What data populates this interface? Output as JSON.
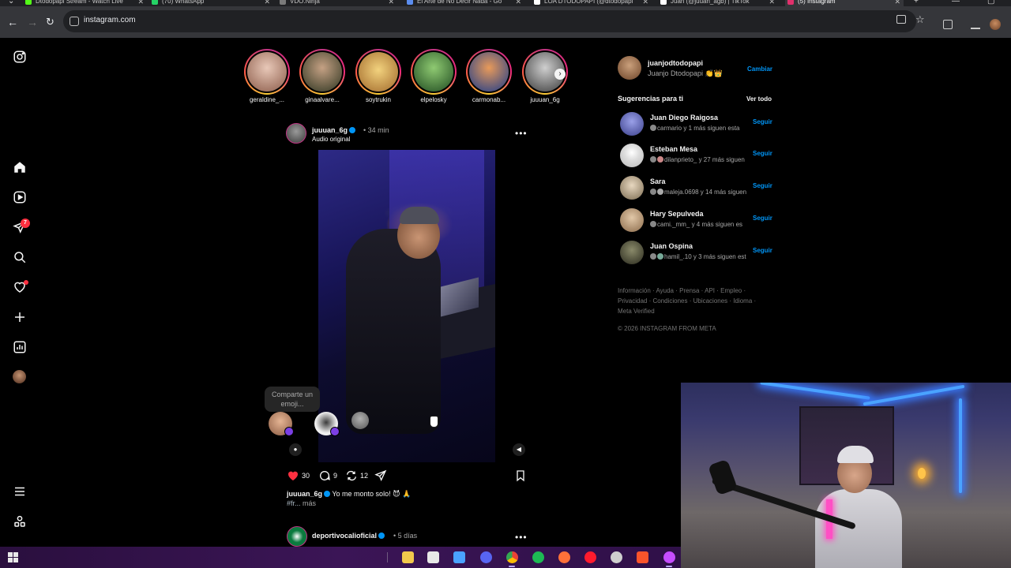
{
  "browser": {
    "tabs": [
      {
        "title": "Dtodopapi Stream - Watch Live",
        "icon": "kick-icon",
        "color": "#53fc18",
        "active": false
      },
      {
        "title": "(70) WhatsApp",
        "icon": "whatsapp-icon",
        "color": "#25d366",
        "active": false
      },
      {
        "title": "VDO.Ninja",
        "icon": "vdo-ninja-icon",
        "color": "#7a7a7a",
        "active": false
      },
      {
        "title": "El Arte de No Decir Nada - Go",
        "icon": "gemini-icon",
        "color": "#5b8def",
        "active": false
      },
      {
        "title": "LOA DTODOPAPI (@dtodopapi",
        "icon": "tiktok-icon",
        "color": "#ffffff",
        "active": false
      },
      {
        "title": "Juan (@juuan_agb) | TikTok",
        "icon": "tiktok-icon",
        "color": "#ffffff",
        "active": false
      },
      {
        "title": "(5) Instagram",
        "icon": "instagram-icon",
        "color": "#e1306c",
        "active": true
      }
    ],
    "url": "instagram.com"
  },
  "rail": {
    "icons": [
      "instagram-logo-icon",
      "home-icon",
      "reels-icon",
      "messages-icon",
      "search-icon",
      "notifications-icon",
      "create-icon",
      "dashboard-icon",
      "profile-avatar",
      "menu-icon",
      "threads-icon"
    ],
    "messages_badge": "7"
  },
  "stories": [
    {
      "name": "geraldine_...",
      "color": "#d4a7a0"
    },
    {
      "name": "ginaalvare...",
      "color": "#5d6b3b"
    },
    {
      "name": "soytrukin",
      "color": "#e0c26a"
    },
    {
      "name": "elpelosky",
      "color": "#3c8a3a"
    },
    {
      "name": "carmonab...",
      "color": "#c65a2a"
    },
    {
      "name": "juuuan_6g",
      "color": "#8a8a8a"
    }
  ],
  "post": {
    "username": "juuuan_6g",
    "time": "34 min",
    "audio": "Audio original",
    "emoji_prompt": "Comparte un emoji...",
    "likes": "30",
    "comments": "9",
    "reposts": "12",
    "caption_user": "juuuan_6g",
    "caption_text": "Yo me monto solo! 😈 🙏",
    "hashtag": "#fr...",
    "more": "más"
  },
  "next_post": {
    "username": "deportivocalioficial",
    "time": "5 días"
  },
  "profile": {
    "username": "juanjodtodopapi",
    "name": "Juanjo Dtodopapi 👏👑",
    "switch": "Cambiar"
  },
  "suggestions": {
    "title": "Sugerencias para ti",
    "see_all": "Ver todo",
    "follow_label": "Seguir",
    "items": [
      {
        "name": "Juan Diego Raigosa",
        "sub": "carmario y 1 más siguen esta",
        "color": "#4a4fa8"
      },
      {
        "name": "Esteban Mesa",
        "sub": "dilanprieto_ y 27 más siguen",
        "color": "#d9d9d9"
      },
      {
        "name": "Sara",
        "sub": "maleja.0698 y 14 más siguen",
        "color": "#b8b0a0"
      },
      {
        "name": "Hary Sepulveda",
        "sub": "cami._mm_ y 4 más siguen es",
        "color": "#b99a7a"
      },
      {
        "name": "Juan Ospina",
        "sub": "hamil_.10 y 3 más siguen est",
        "color": "#5a5a48"
      }
    ]
  },
  "footer": {
    "links": "Información · Ayuda · Prensa · API · Empleo · Privacidad · Condiciones · Ubicaciones · Idioma · Meta Verified",
    "copyright": "© 2026 INSTAGRAM FROM META"
  },
  "taskbar": {
    "apps": [
      {
        "icon": "file-explorer-icon",
        "color": "#f2c94c"
      },
      {
        "icon": "microsoft-store-icon",
        "color": "#e8e8e8"
      },
      {
        "icon": "streaming-app-icon",
        "color": "#4aa3ff"
      },
      {
        "icon": "discord-icon",
        "color": "#5865f2"
      },
      {
        "icon": "chrome-icon",
        "color": "#34a853"
      },
      {
        "icon": "spotify-icon",
        "color": "#1db954"
      },
      {
        "icon": "firefox-icon",
        "color": "#ff7139"
      },
      {
        "icon": "opera-icon",
        "color": "#ff1b2d"
      },
      {
        "icon": "obs-icon",
        "color": "#cfcfcf"
      },
      {
        "icon": "brave-icon",
        "color": "#fb542b"
      },
      {
        "icon": "browser-active-icon",
        "color": "#c64dff"
      }
    ]
  }
}
